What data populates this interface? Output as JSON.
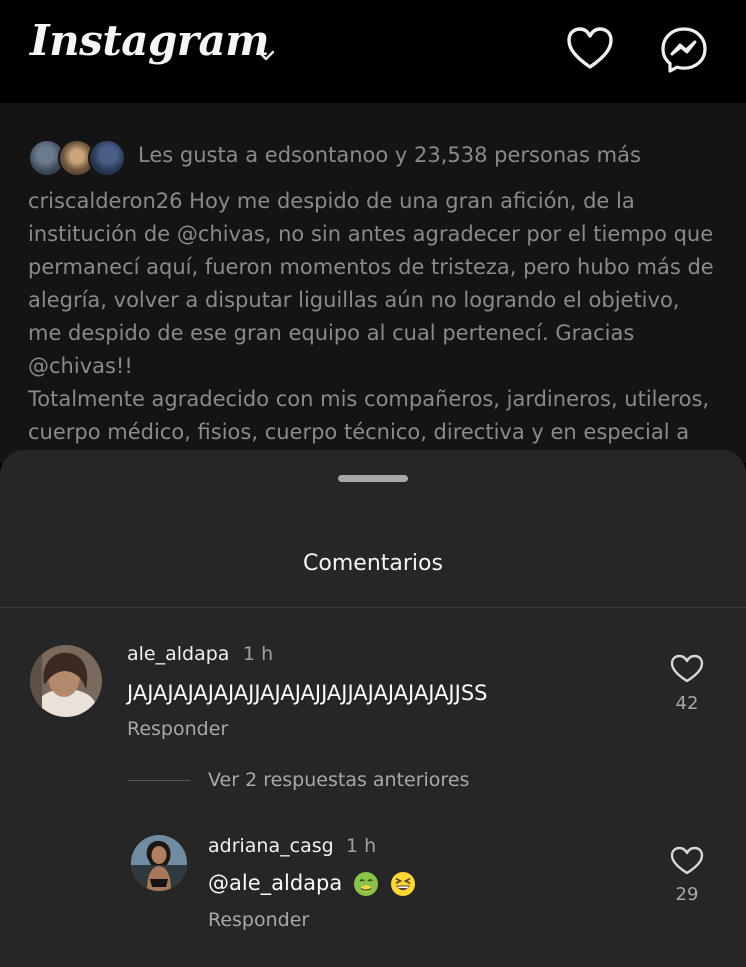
{
  "header": {
    "logo_text": "Instagram",
    "icons": [
      "chevron-down-icon",
      "heart-icon",
      "messenger-icon"
    ]
  },
  "post": {
    "likes_text": "Les gusta a edsontanoo y 23,538 personas más",
    "caption": "criscalderon26 Hoy me despido de una gran afición, de la\ninstitución de @chivas, no sin antes agradecer por el tiempo que\npermanecí aquí, fueron momentos de tristeza, pero hubo más  de\nalegría, volver a disputar liguillas aún no logrando el objetivo,\nme despido de ese gran equipo al cual pertenecí. Gracias\n@chivas!!\nTotalmente agradecido con mis compañeros, jardineros, utileros,\ncuerpo médico, fisios, cuerpo técnico, directiva y en especial a"
  },
  "comments_sheet": {
    "title": "Comentarios",
    "comments": [
      {
        "username": "ale_aldapa",
        "time": "1 h",
        "text": "JAJAJAJAJAJAJJAJAJAJJAJJAJAJAJAJAJJSS",
        "reply_label": "Responder",
        "likes": "42"
      }
    ],
    "view_replies_label": "Ver 2 respuestas anteriores",
    "replies": [
      {
        "username": "adriana_casg",
        "time": "1 h",
        "text": "@ale_aldapa",
        "emojis": [
          "nauseated-face-emoji",
          "grinning-squinting-face-emoji"
        ],
        "reply_label": "Responder",
        "likes": "29"
      }
    ]
  },
  "colors": {
    "background": "#000000",
    "sheet": "#262626",
    "muted_text": "#a8a8a8",
    "dimmed_post": "#141414"
  }
}
